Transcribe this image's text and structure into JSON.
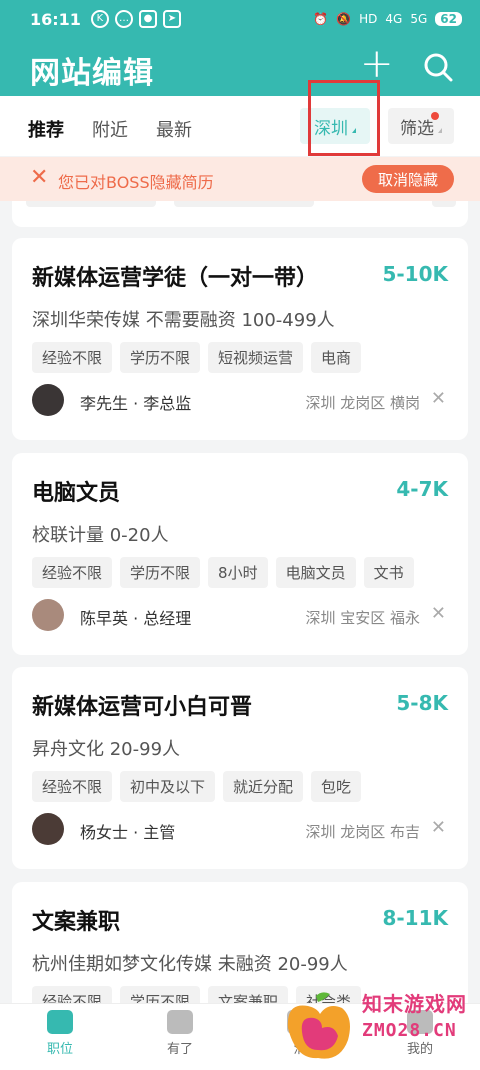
{
  "status_bar": {
    "time": "16:11",
    "battery": "62",
    "signal_labels": [
      "HD",
      "4G",
      "5G"
    ]
  },
  "header": {
    "title": "网站编辑",
    "plus_icon": "plus-icon",
    "search_icon": "search-icon"
  },
  "tabs": [
    {
      "label": "推荐",
      "active": true
    },
    {
      "label": "附近",
      "active": false
    },
    {
      "label": "最新",
      "active": false
    }
  ],
  "city_chip": {
    "label": "深圳"
  },
  "filter_chip": {
    "label": "筛选"
  },
  "notice": {
    "text": "您已对BOSS隐藏简历",
    "button": "取消隐藏"
  },
  "jobs": [
    {
      "title": "新媒体运营学徒（一对一带）",
      "salary": "5-10K",
      "company": "深圳华荣传媒  不需要融资  100-499人",
      "tags": [
        "经验不限",
        "学历不限",
        "短视频运营",
        "电商"
      ],
      "recruiter": "李先生 · 李总监",
      "location": "深圳  龙岗区  横岗"
    },
    {
      "title": "电脑文员",
      "salary": "4-7K",
      "company": "校联计量  0-20人",
      "tags": [
        "经验不限",
        "学历不限",
        "8小时",
        "电脑文员",
        "文书"
      ],
      "recruiter": "陈早英 · 总经理",
      "location": "深圳  宝安区  福永"
    },
    {
      "title": "新媒体运营可小白可晋",
      "salary": "5-8K",
      "company": "昇舟文化  20-99人",
      "tags": [
        "经验不限",
        "初中及以下",
        "就近分配",
        "包吃"
      ],
      "recruiter": "杨女士 · 主管",
      "location": "深圳  龙岗区  布吉"
    },
    {
      "title": "文案兼职",
      "salary": "8-11K",
      "company": "杭州佳期如梦文化传媒  未融资  20-99人",
      "tags": [
        "经验不限",
        "学历不限",
        "文案兼职",
        "社会类"
      ],
      "recruiter": "",
      "location": ""
    }
  ],
  "bottom_nav": [
    {
      "label": "职位",
      "active": true
    },
    {
      "label": "有了",
      "active": false
    },
    {
      "label": "消",
      "active": false
    },
    {
      "label": "我的",
      "active": false
    }
  ],
  "watermark": {
    "line1": "知末游戏网",
    "line2": "ZMO28.CN"
  },
  "colors": {
    "brand": "#36b9b0",
    "notice": "#ef6c4a",
    "highlight": "#e03a3a"
  }
}
